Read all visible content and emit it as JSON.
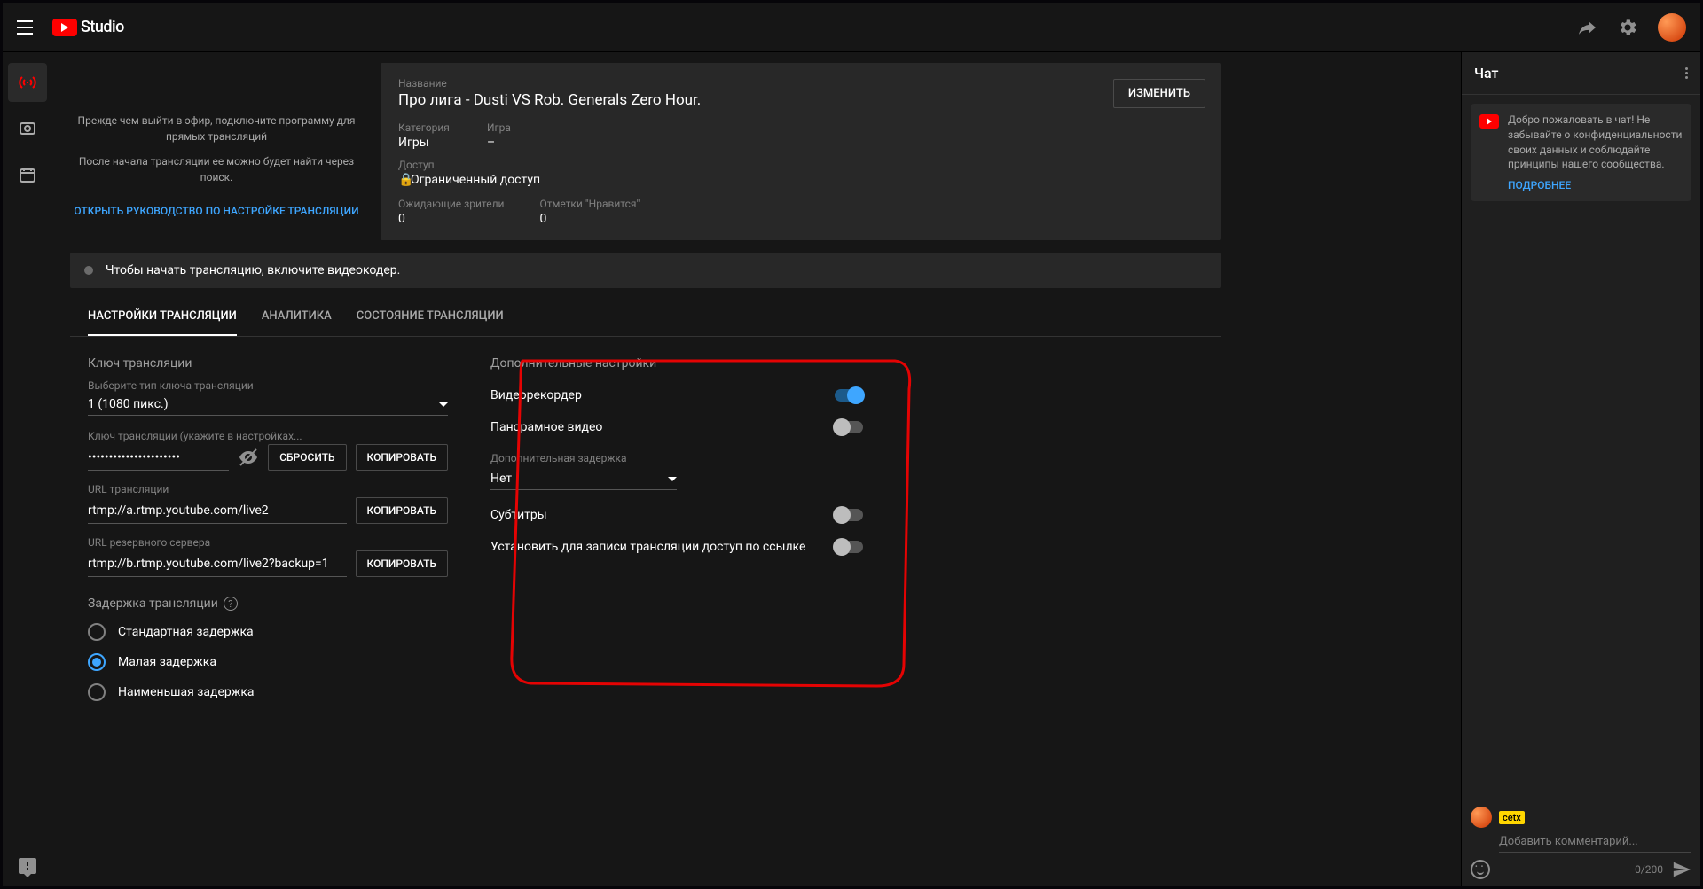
{
  "brand": "Studio",
  "stream": {
    "title_label": "Название",
    "title": "Про лига - Dusti VS Rob. Generals Zero Hour.",
    "category_label": "Категория",
    "category": "Игры",
    "game_label": "Игра",
    "game": "–",
    "access_label": "Доступ",
    "access": "Ограниченный доступ",
    "waiting_label": "Ожидающие зрители",
    "waiting": "0",
    "likes_label": "Отметки \"Нравится\"",
    "likes": "0",
    "edit_btn": "ИЗМЕНИТЬ"
  },
  "preview": {
    "text1": "Прежде чем выйти в эфир, подключите программу для прямых трансляций",
    "text2": "После начала трансляции ее можно будет найти через поиск.",
    "guide_link": "ОТКРЫТЬ РУКОВОДСТВО ПО НАСТРОЙКЕ ТРАНСЛЯЦИИ"
  },
  "status": "Чтобы начать трансляцию, включите видеокодер.",
  "tabs": [
    "НАСТРОЙКИ ТРАНСЛЯЦИИ",
    "АНАЛИТИКА",
    "СОСТОЯНИЕ ТРАНСЛЯЦИИ"
  ],
  "settings": {
    "key_title": "Ключ трансляции",
    "key_type_hint": "Выберите тип ключа трансляции",
    "key_type_value": "1 (1080 пикс.)",
    "key_hint": "Ключ трансляции (укажите в настройках...",
    "key_value": "••••••••••••••••••••••",
    "reset_btn": "СБРОСИТЬ",
    "copy_btn": "КОПИРОВАТЬ",
    "url_hint": "URL трансляции",
    "url_value": "rtmp://a.rtmp.youtube.com/live2",
    "backup_hint": "URL резервного сервера",
    "backup_value": "rtmp://b.rtmp.youtube.com/live2?backup=1",
    "delay_title": "Задержка трансляции",
    "delay_options": [
      "Стандартная задержка",
      "Малая задержка",
      "Наименьшая задержка"
    ],
    "extra_title": "Дополнительные настройки",
    "dvr": "Видеорекордер",
    "pano": "Панорамное видео",
    "extra_delay_hint": "Дополнительная задержка",
    "extra_delay_value": "Нет",
    "subs": "Субтитры",
    "unlisted": "Установить для записи трансляции доступ по ссылке"
  },
  "chat": {
    "title": "Чат",
    "welcome": "Добро пожаловать в чат! Не забывайте о конфиденциальности своих данных и соблюдайте принципы нашего сообщества.",
    "learn_more": "ПОДРОБНЕЕ",
    "username": "cetx",
    "placeholder": "Добавить комментарий...",
    "count": "0/200"
  }
}
